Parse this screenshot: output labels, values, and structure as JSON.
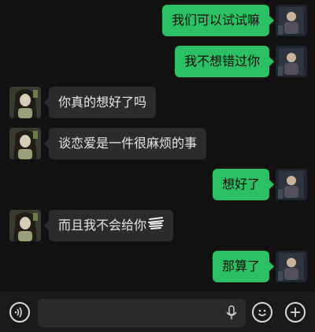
{
  "messages": [
    {
      "side": "out",
      "text": "我们可以试试嘛"
    },
    {
      "side": "out",
      "text": "我不想错过你"
    },
    {
      "side": "in",
      "text": "你真的想好了吗"
    },
    {
      "side": "in",
      "text": "谈恋爱是一件很麻烦的事"
    },
    {
      "side": "out",
      "text": "想好了"
    },
    {
      "side": "in",
      "text": "而且我不会给你",
      "trailing": "scribbled-out-text"
    },
    {
      "side": "out",
      "text": "那算了"
    }
  ],
  "input_bar": {
    "icons": [
      "voice-icon",
      "microphone-icon",
      "emoji-icon",
      "plus-icon"
    ]
  },
  "colors": {
    "background": "#111111",
    "outgoing_bubble": "#2bc063",
    "incoming_bubble": "#2c2c2c"
  }
}
